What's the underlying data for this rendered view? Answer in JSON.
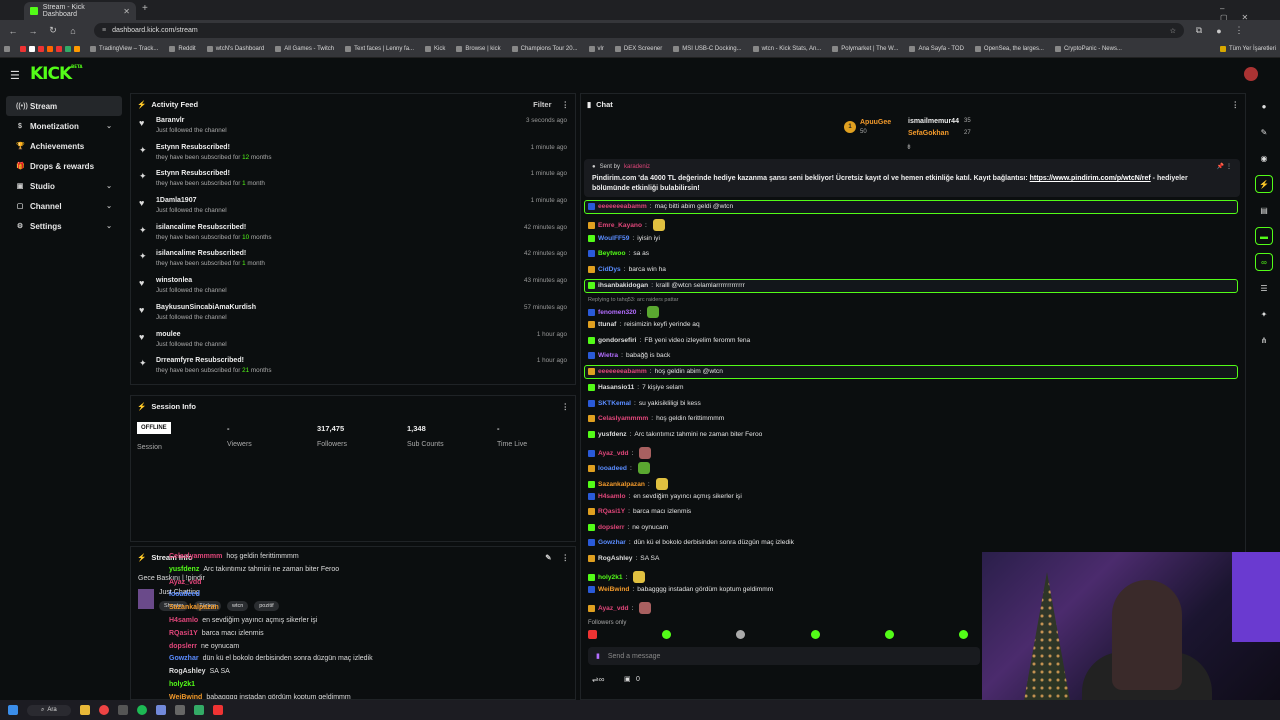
{
  "browser": {
    "tab_title": "Stream - Kick Dashboard",
    "url": "dashboard.kick.com/stream",
    "bookmarks": [
      "TradingView – Track...",
      "Reddit",
      "wtcN's Dashboard",
      "All Games - Twitch",
      "Text faces | Lenny fa...",
      "Kick",
      "Browse | kick",
      "Champions Tour 20...",
      "vlr",
      "DEX Screener",
      "MSI USB-C Docking...",
      "wtcn - Kick Stats, An...",
      "Polymarket | The W...",
      "Ana Sayfa - TOD",
      "OpenSea, the larges...",
      "CryptoPanic - News..."
    ],
    "all_bookmarks": "Tüm Yer İşaretleri"
  },
  "brand": {
    "logo": "KICK",
    "beta": "BETA",
    "accent": "#53fc18"
  },
  "sidebar": {
    "items": [
      {
        "label": "Stream",
        "icon": "stream-icon"
      },
      {
        "label": "Monetization",
        "icon": "money-icon"
      },
      {
        "label": "Achievements",
        "icon": "trophy-icon"
      },
      {
        "label": "Drops & rewards",
        "icon": "gift-icon"
      },
      {
        "label": "Studio",
        "icon": "studio-icon"
      },
      {
        "label": "Channel",
        "icon": "channel-icon"
      },
      {
        "label": "Settings",
        "icon": "gear-icon"
      }
    ]
  },
  "activity": {
    "title": "Activity Feed",
    "filter": "Filter",
    "rows": [
      {
        "name": "Baranvlr",
        "sub": "Just followed the channel",
        "time": "3 seconds ago",
        "type": "follow"
      },
      {
        "name": "Estynn Resubscribed!",
        "sub_pre": "they have been subscribed for ",
        "sub_bold": "12",
        "sub_post": " months",
        "time": "1 minute ago",
        "type": "sub"
      },
      {
        "name": "Estynn Resubscribed!",
        "sub_pre": "they have been subscribed for ",
        "sub_bold": "1",
        "sub_post": " month",
        "time": "1 minute ago",
        "type": "sub"
      },
      {
        "name": "1Damla1907",
        "sub": "Just followed the channel",
        "time": "1 minute ago",
        "type": "follow"
      },
      {
        "name": "isilancalime Resubscribed!",
        "sub_pre": "they have been subscribed for ",
        "sub_bold": "10",
        "sub_post": " months",
        "time": "42 minutes ago",
        "type": "sub"
      },
      {
        "name": "isilancalime Resubscribed!",
        "sub_pre": "they have been subscribed for ",
        "sub_bold": "1",
        "sub_post": " month",
        "time": "42 minutes ago",
        "type": "sub"
      },
      {
        "name": "winstonlea",
        "sub": "Just followed the channel",
        "time": "43 minutes ago",
        "type": "follow"
      },
      {
        "name": "BaykusunSincabiAmaKurdish",
        "sub": "Just followed the channel",
        "time": "57 minutes ago",
        "type": "follow"
      },
      {
        "name": "moulee",
        "sub": "Just followed the channel",
        "time": "1 hour ago",
        "type": "follow"
      },
      {
        "name": "Drreamfyre Resubscribed!",
        "sub_pre": "they have been subscribed for ",
        "sub_bold": "21",
        "sub_post": " months",
        "time": "1 hour ago",
        "type": "sub"
      }
    ]
  },
  "session": {
    "title": "Session Info",
    "status": "OFFLINE",
    "session_label": "Session",
    "stats": [
      {
        "value": "-",
        "label": "Viewers"
      },
      {
        "value": "317,475",
        "label": "Followers"
      },
      {
        "value": "1,348",
        "label": "Sub Counts"
      },
      {
        "value": "-",
        "label": "Time Live"
      }
    ]
  },
  "streaminfo": {
    "title": "Stream Info",
    "title_text": "Gece Baskını | !pindir",
    "category": "Just Chatting",
    "tags": [
      "Shooter",
      "Türkçe",
      "wtcn",
      "pozitif"
    ]
  },
  "chat": {
    "title": "Chat",
    "leaders": [
      {
        "rank": "1",
        "name": "ApuuGee",
        "count": "50"
      },
      {
        "name": "ismailmemur44",
        "count": "35"
      },
      {
        "name": "SefaGokhan",
        "count": "27"
      }
    ],
    "pinned_by": "Sent by",
    "pinned_user": "karadeniz",
    "pinned_text": "Pindirim.com 'da 4000 TL değerinde hediye kazanma şansı seni bekliyor! Ücretsiz kayıt ol ve hemen etkinliğe katıl. Kayıt bağlantısı: ",
    "pinned_link": "https://www.pindirim.com/p/wtcN/ref",
    "pinned_tail": " - hediyeler bölümünde etkinliği bulabilirsin!",
    "reply_note": "Replying to tahq53: arc raiders pattar",
    "followers_only": "Followers only",
    "send_placeholder": "Send a message",
    "viewers_count": "0",
    "messages": [
      {
        "user": "eeeeeeeabamm",
        "text": "maç bitti abim geldi @wtcn",
        "color": "#e0467a",
        "hl": true
      },
      {
        "user": "Emre_Kayano",
        "text": "",
        "color": "#e0467a",
        "emote": "y"
      },
      {
        "user": "WoulFF59",
        "text": "iyisin iyi",
        "color": "#5a8cff"
      },
      {
        "user": "Beytwoo",
        "text": "sa as",
        "color": "#53fc18"
      },
      {
        "user": "CidDys",
        "text": "barca win ha",
        "color": "#5a8cff"
      },
      {
        "user": "ihsanbakidogan",
        "text": "kralll @wtcn selamlarrrrrrrrrrrrr",
        "color": "#dddddd",
        "hl": true
      },
      {
        "user": "fenomen320",
        "text": "",
        "color": "#b36dff",
        "emote": "g"
      },
      {
        "user": "ttunaf",
        "text": "reisimizin keyfi yerinde aq",
        "color": "#dddddd"
      },
      {
        "user": "gondorsefiri",
        "text": "FB yeni video izleyelim feromm fena",
        "color": "#dddddd"
      },
      {
        "user": "Wietra",
        "text": "babağğ is back",
        "color": "#b36dff"
      },
      {
        "user": "eeeeeeeabamm",
        "text": "hoş geldin abim @wtcn",
        "color": "#e0467a",
        "hl": true
      },
      {
        "user": "Hasansio11",
        "text": "7 kişiye selam",
        "color": "#dddddd"
      },
      {
        "user": "SKTKemal",
        "text": "su yakisikliligi bi kess",
        "color": "#5a8cff"
      },
      {
        "user": "Celaslyammmm",
        "text": "hoş geldin ferittimmmm",
        "color": "#e0467a"
      },
      {
        "user": "yusfdenz",
        "text": "Arc takıntımız tahmini ne zaman biter Feroo",
        "color": "#dddddd"
      },
      {
        "user": "Ayaz_vdd",
        "text": "",
        "color": "#e0467a",
        "emote": "r"
      },
      {
        "user": "looadeed",
        "text": "",
        "color": "#5a8cff",
        "emote": "g"
      },
      {
        "user": "Sazankalpazan",
        "text": "",
        "color": "#f39a2b",
        "emote": "y"
      },
      {
        "user": "H4samlo",
        "text": "en sevdiğim yayıncı açmış sikerler işi",
        "color": "#e0467a"
      },
      {
        "user": "RQasi1Y",
        "text": "barca macı izlenmis",
        "color": "#e0467a"
      },
      {
        "user": "dopslerr",
        "text": "ne oynucam",
        "color": "#e0467a"
      },
      {
        "user": "Gowzhar",
        "text": "dün kü el bokolo derbisinden sonra düzgün maç izledik",
        "color": "#5a8cff"
      },
      {
        "user": "RogAshley",
        "text": "SA SA",
        "color": "#dddddd"
      },
      {
        "user": "holy2k1",
        "text": "",
        "color": "#53fc18",
        "emote": "y"
      },
      {
        "user": "WeiBwind",
        "text": "babagggg instadan gördüm koptum geldimmm",
        "color": "#f39a2b"
      },
      {
        "user": "Ayaz_vdd",
        "text": "",
        "color": "#e0467a",
        "emote": "r"
      }
    ]
  },
  "overlay_chat": [
    {
      "user": "Celaslyammmm",
      "text": "hoş geldin ferittimmmm",
      "color": "#e0467a"
    },
    {
      "user": "yusfdenz",
      "text": "Arc takıntımız tahmini ne zaman biter Feroo",
      "color": "#53fc18"
    },
    {
      "user": "Ayaz_vdd",
      "text": "",
      "color": "#e0467a"
    },
    {
      "user": "looadeed",
      "text": "",
      "color": "#5a8cff"
    },
    {
      "user": "Sazankalpazan",
      "text": "",
      "color": "#f39a2b"
    },
    {
      "user": "H4samlo",
      "text": "en sevdiğim yayıncı açmış sikerler işi",
      "color": "#e0467a"
    },
    {
      "user": "RQasi1Y",
      "text": "barca macı izlenmis",
      "color": "#e0467a"
    },
    {
      "user": "dopslerr",
      "text": "ne oynucam",
      "color": "#e0467a"
    },
    {
      "user": "Gowzhar",
      "text": "dün kü el bokolo derbisinden sonra düzgün maç izledik",
      "color": "#5a8cff"
    },
    {
      "user": "RogAshley",
      "text": "SA SA",
      "color": "#dddddd"
    },
    {
      "user": "holy2k1",
      "text": "",
      "color": "#53fc18"
    },
    {
      "user": "WeiBwind",
      "text": "babagggg instadan gördüm koptum geldimmm",
      "color": "#f39a2b"
    }
  ],
  "taskbar": {
    "search": "Ara"
  }
}
